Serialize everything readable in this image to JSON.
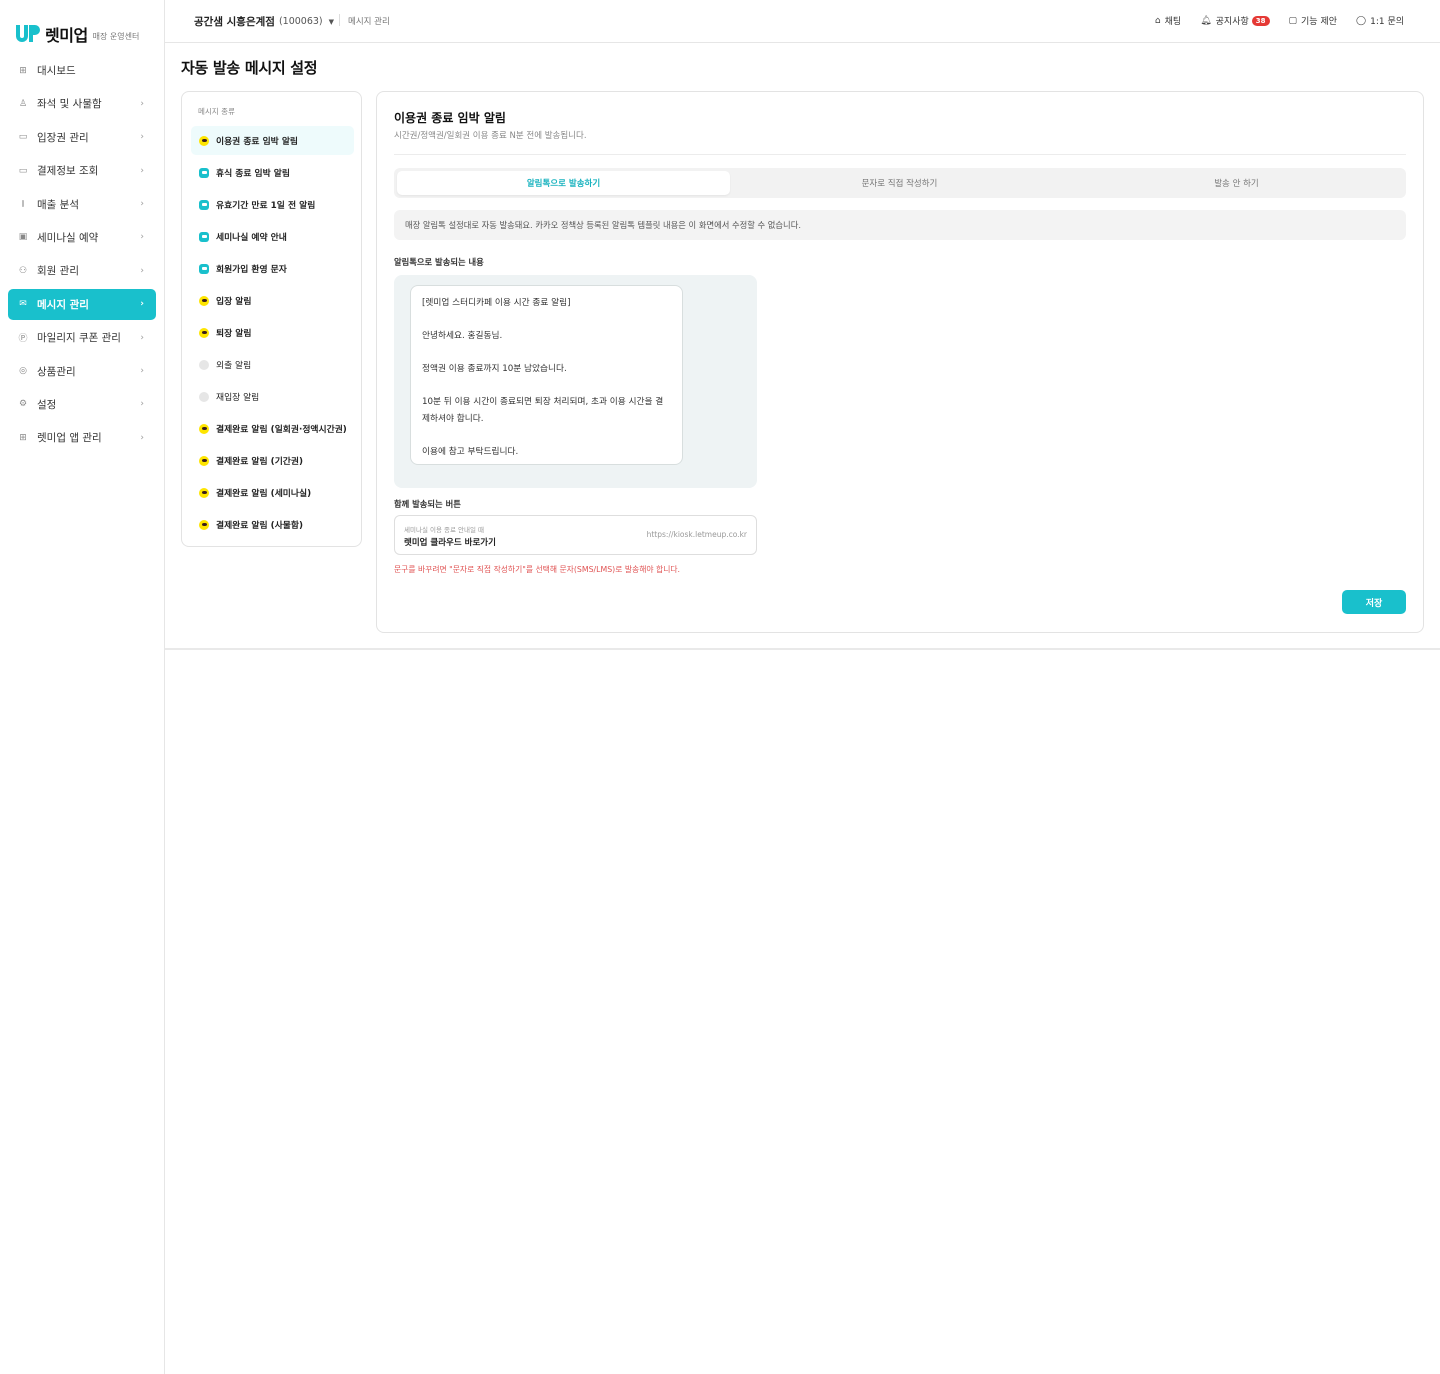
{
  "brand": {
    "name": "렛미업",
    "sub": "매장 운영센터",
    "accent": "#19c0cc"
  },
  "sidebar": {
    "items": [
      {
        "label": "대시보드",
        "icon": "dashboard-icon",
        "glyph": "⊞",
        "chevron": ""
      },
      {
        "label": "좌석 및 사물함",
        "icon": "seat-icon",
        "glyph": "♙",
        "chevron": "›"
      },
      {
        "label": "입장권 관리",
        "icon": "ticket-icon",
        "glyph": "▭",
        "chevron": "›"
      },
      {
        "label": "결제정보 조회",
        "icon": "card-icon",
        "glyph": "▭",
        "chevron": "›"
      },
      {
        "label": "매출 분석",
        "icon": "chart-icon",
        "glyph": "⫾",
        "chevron": "›"
      },
      {
        "label": "세미나실 예약",
        "icon": "calendar-icon",
        "glyph": "▣",
        "chevron": "›"
      },
      {
        "label": "회원 관리",
        "icon": "users-icon",
        "glyph": "⚇",
        "chevron": "›"
      },
      {
        "label": "메시지 관리",
        "icon": "mail-icon",
        "glyph": "✉",
        "chevron": "›",
        "active": true
      },
      {
        "label": "마일리지 쿠폰 관리",
        "icon": "mileage-icon",
        "glyph": "Ⓟ",
        "chevron": "›"
      },
      {
        "label": "상품관리",
        "icon": "product-icon",
        "glyph": "◎",
        "chevron": "›"
      },
      {
        "label": "설정",
        "icon": "gear-icon",
        "glyph": "⚙",
        "chevron": "›"
      },
      {
        "label": "렛미업 앱 관리",
        "icon": "app-icon",
        "glyph": "⊞",
        "chevron": "›"
      }
    ]
  },
  "header": {
    "store_name": "공간샘 시흥은계점",
    "store_code": "(100063)",
    "breadcrumb": "메시지 관리",
    "links": [
      {
        "label": "채팅",
        "icon": "chat-icon",
        "glyph": "⌂"
      },
      {
        "label": "공지사항",
        "icon": "bell-icon",
        "glyph": "🔔︎",
        "badge": "38"
      },
      {
        "label": "기능 제안",
        "icon": "suggest-icon",
        "glyph": "▢"
      },
      {
        "label": "1:1 문의",
        "icon": "inquiry-icon",
        "glyph": "◯"
      }
    ]
  },
  "page": {
    "title": "자동 발송 메시지 설정"
  },
  "types": {
    "label": "메시지 종류",
    "items": [
      {
        "label": "이용권 종료 임박 알림",
        "kind": "kakao",
        "active": true
      },
      {
        "label": "휴식 종료 임박 알림",
        "kind": "sms"
      },
      {
        "label": "유효기간 만료 1일 전 알림",
        "kind": "sms"
      },
      {
        "label": "세미나실 예약 안내",
        "kind": "sms"
      },
      {
        "label": "회원가입 환영 문자",
        "kind": "sms"
      },
      {
        "label": "입장 알림",
        "kind": "kakao"
      },
      {
        "label": "퇴장 알림",
        "kind": "kakao"
      },
      {
        "label": "외출 알림",
        "kind": "none"
      },
      {
        "label": "재입장 알림",
        "kind": "none"
      },
      {
        "label": "결제완료 알림 (일회권·정액시간권)",
        "kind": "kakao"
      },
      {
        "label": "결제완료 알림 (기간권)",
        "kind": "kakao"
      },
      {
        "label": "결제완료 알림 (세미나실)",
        "kind": "kakao"
      },
      {
        "label": "결제완료 알림 (사물함)",
        "kind": "kakao"
      }
    ]
  },
  "detail": {
    "title": "이용권 종료 임박 알림",
    "desc": "시간권/정액권/일회권 이용 종료 N분 전에 발송됩니다.",
    "tabs": [
      "알림톡으로 발송하기",
      "문자로 직접 작성하기",
      "발송 안 하기"
    ],
    "notice": "매장 알림톡 설정대로 자동 발송돼요. 카카오 정책상 등록된 알림톡 템플릿 내용은 이 화면에서 수정할 수 없습니다.",
    "content_label": "알림톡으로 발송되는 내용",
    "message": "[렛미업 스터디카페 이용 시간 종료 알림]\n\n안녕하세요. 홍길동님.\n\n정액권 이용 종료까지 10분 남았습니다.\n\n10분 뒤 이용 시간이 종료되면 퇴장 처리되며, 초과 이용 시간을 결제하셔야 합니다.\n\n이용에 참고 부탁드립니다.",
    "button_label": "함께 발송되는 버튼",
    "button_caption": "세미나실 이용 종료 안내일 때",
    "button_name": "렛미업 클라우드 바로가기",
    "button_url": "https://kiosk.letmeup.co.kr",
    "warning": "문구를 바꾸려면 \"문자로 직접 작성하기\"를 선택해 문자(SMS/LMS)로 발송해야 합니다.",
    "save_label": "저장"
  }
}
